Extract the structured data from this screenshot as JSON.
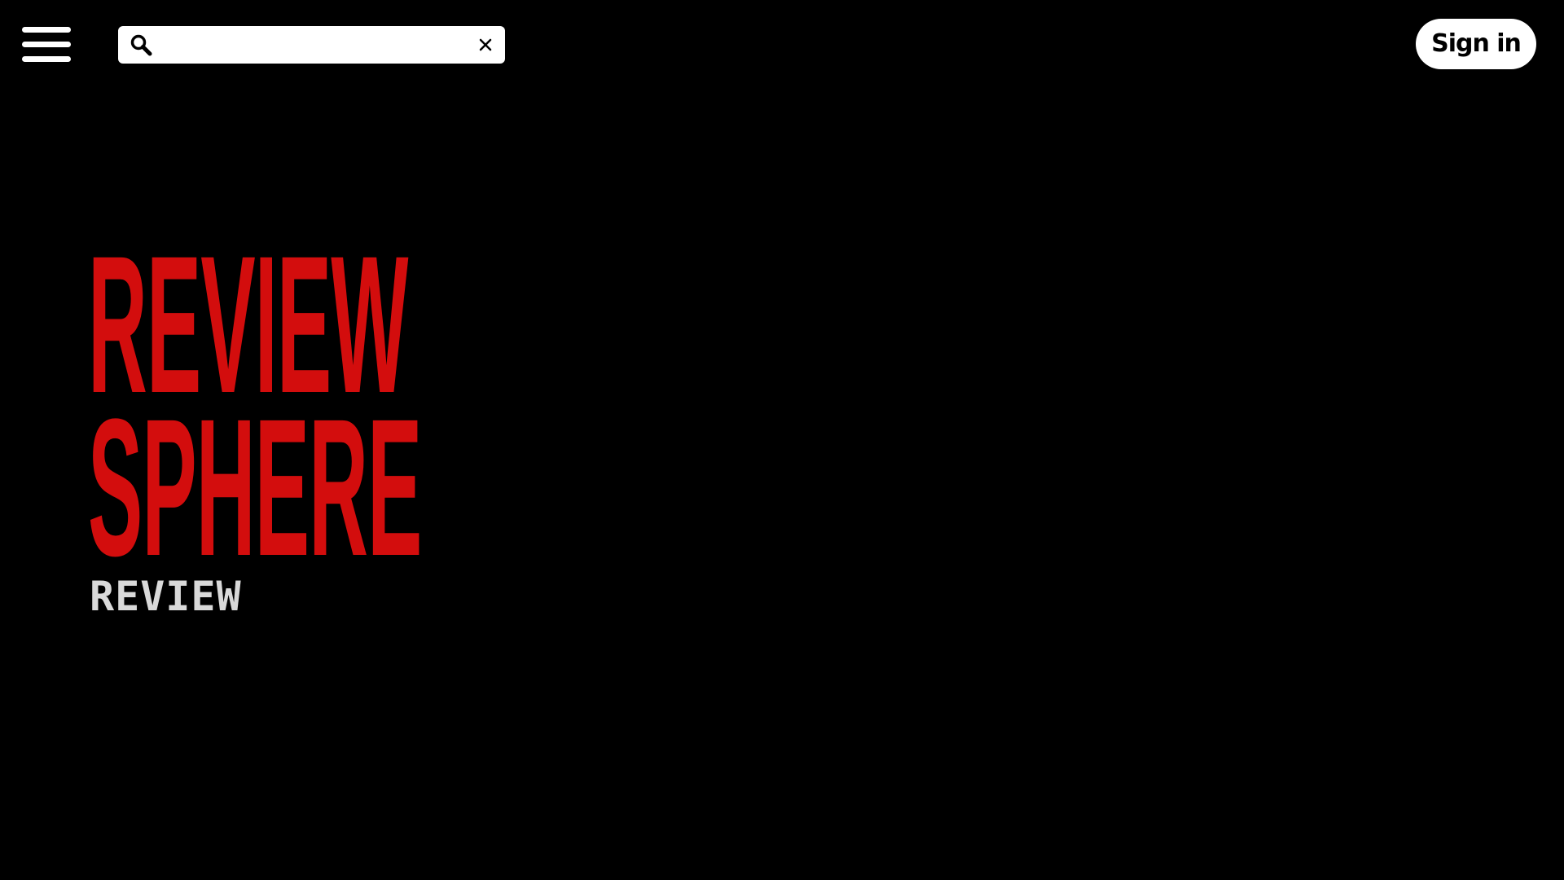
{
  "header": {
    "menu_icon": "hamburger-menu-icon",
    "search": {
      "value": "",
      "placeholder": "",
      "search_icon": "search-icon",
      "clear_icon": "close-icon"
    },
    "sign_in_label": "Sign in"
  },
  "hero": {
    "logo_line_1": "REVIEW",
    "logo_line_2": "SPHERE",
    "subtitle": "REVIEW"
  },
  "colors": {
    "background": "#000000",
    "logo_red": "#d30d0d",
    "subtitle_gray": "#d9d9d9",
    "button_white": "#ffffff"
  }
}
